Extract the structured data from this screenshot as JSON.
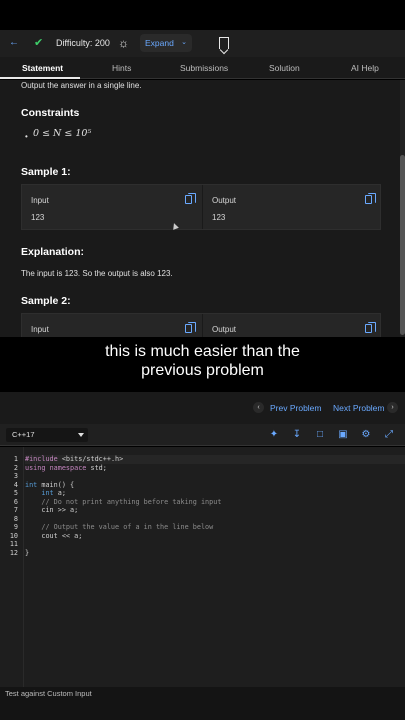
{
  "toolbar": {
    "difficulty": "Difficulty: 200",
    "expand_label": "Expand"
  },
  "tabs": [
    {
      "label": "Statement"
    },
    {
      "label": "Hints"
    },
    {
      "label": "Submissions"
    },
    {
      "label": "Solution"
    },
    {
      "label": "AI Help"
    }
  ],
  "statement": {
    "output_line": "Output the answer in a single line.",
    "constraints_heading": "Constraints",
    "constraint": "0 ≤ N ≤ 10⁵",
    "sample1_heading": "Sample 1:",
    "sample1": {
      "input_label": "Input",
      "input_value": "123",
      "output_label": "Output",
      "output_value": "123"
    },
    "explanation_heading": "Explanation:",
    "explanation_text": "The input is 123. So the output is also 123.",
    "sample2_heading": "Sample 2:",
    "sample2": {
      "input_label": "Input",
      "output_label": "Output"
    }
  },
  "caption": {
    "line1": "this is much easier than the",
    "line2": "previous problem"
  },
  "nav": {
    "prev": "Prev Problem",
    "next": "Next Problem"
  },
  "editor": {
    "language": "C++17",
    "line_numbers": [
      "1",
      "2",
      "3",
      "4",
      "5",
      "6",
      "7",
      "8",
      "9",
      "10",
      "11",
      "12"
    ]
  },
  "bottom": {
    "text": "Test against Custom Input"
  }
}
